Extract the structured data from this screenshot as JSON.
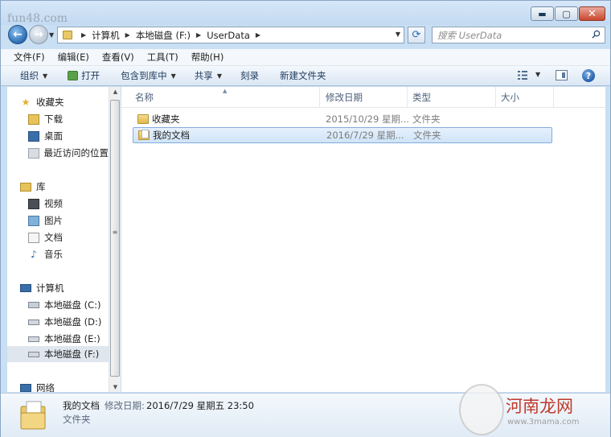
{
  "title": {
    "watermark": "fun48.com"
  },
  "window_controls": {
    "minimize": "▬",
    "maximize": "▢",
    "close": "✕"
  },
  "address": {
    "crumbs": [
      "计算机",
      "本地磁盘 (F:)",
      "UserData"
    ]
  },
  "search": {
    "placeholder": "搜索 UserData"
  },
  "menu": [
    "文件(F)",
    "编辑(E)",
    "查看(V)",
    "工具(T)",
    "帮助(H)"
  ],
  "toolbar": {
    "organize": "组织",
    "open": "打开",
    "include": "包含到库中",
    "share": "共享",
    "burn": "刻录",
    "new_folder": "新建文件夹"
  },
  "sidebar": {
    "favorites": {
      "label": "收藏夹",
      "items": [
        "下载",
        "桌面",
        "最近访问的位置"
      ]
    },
    "libraries": {
      "label": "库",
      "items": [
        "视频",
        "图片",
        "文档",
        "音乐"
      ]
    },
    "computer": {
      "label": "计算机",
      "items": [
        "本地磁盘 (C:)",
        "本地磁盘 (D:)",
        "本地磁盘 (E:)",
        "本地磁盘 (F:)"
      ]
    },
    "network": {
      "label": "网络"
    }
  },
  "columns": {
    "name": "名称",
    "modified": "修改日期",
    "type": "类型",
    "size": "大小"
  },
  "files": [
    {
      "name": "收藏夹",
      "modified": "2015/10/29 星期...",
      "type": "文件夹"
    },
    {
      "name": "我的文档",
      "modified": "2016/7/29 星期...",
      "type": "文件夹"
    }
  ],
  "details": {
    "name": "我的文档",
    "date_label": "修改日期:",
    "date_value": "2016/7/29 星期五 23:50",
    "type": "文件夹"
  },
  "watermark": {
    "brand": "河南龙网",
    "url": "www.3mama.com"
  },
  "colors": {
    "selection": "#cfe4f8",
    "selection_border": "#84acdd",
    "chrome": "#c9dff3"
  }
}
